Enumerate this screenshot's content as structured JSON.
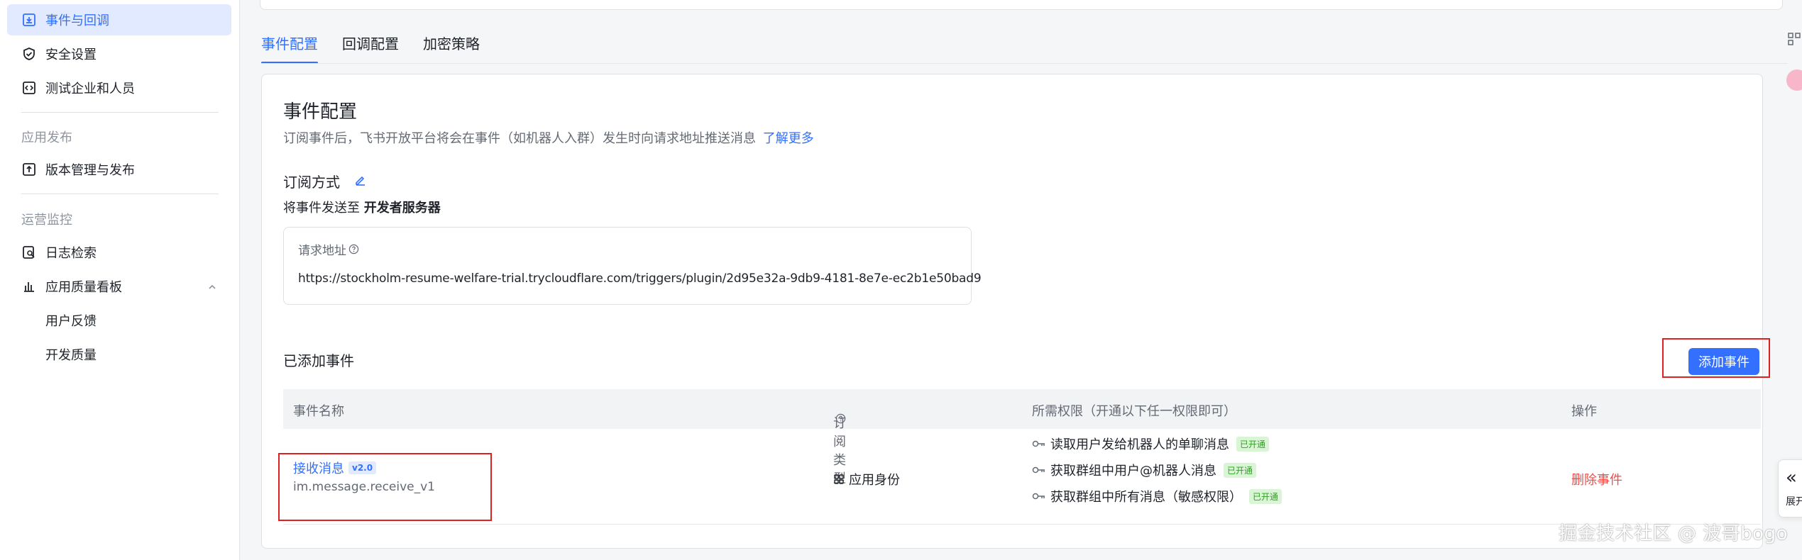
{
  "sidebar": {
    "items": [
      {
        "label": "事件与回调",
        "icon": "event-callback-icon",
        "active": true
      },
      {
        "label": "安全设置",
        "icon": "shield-icon"
      },
      {
        "label": "测试企业和人员",
        "icon": "code-box-icon"
      }
    ],
    "group_publish": "应用发布",
    "publish_items": [
      {
        "label": "版本管理与发布",
        "icon": "upload-box-icon"
      }
    ],
    "group_monitor": "运营监控",
    "monitor_items": [
      {
        "label": "日志检索",
        "icon": "log-search-icon"
      },
      {
        "label": "应用质量看板",
        "icon": "bar-chart-icon"
      }
    ],
    "sub_items": [
      {
        "label": "用户反馈"
      },
      {
        "label": "开发质量"
      }
    ]
  },
  "tabs": [
    {
      "label": "事件配置",
      "active": true
    },
    {
      "label": "回调配置"
    },
    {
      "label": "加密策略"
    }
  ],
  "section": {
    "title": "事件配置",
    "description": "订阅事件后，飞书开放平台将会在事件（如机器人入群）发生时向请求地址推送消息",
    "learn_more": "了解更多",
    "subscribe_mode_title": "订阅方式",
    "send_to_prefix": "将事件发送至",
    "send_to_target": "开发者服务器",
    "request_url_label": "请求地址",
    "request_url": "https://stockholm-resume-welfare-trial.trycloudflare.com/triggers/plugin/2d95e32a-9db9-4181-8e7e-ec2b1e50bad9"
  },
  "events": {
    "title": "已添加事件",
    "add_button": "添加事件",
    "columns": {
      "name": "事件名称",
      "sub_type": "订阅类型",
      "permissions": "所需权限（开通以下任一权限即可）",
      "actions": "操作"
    },
    "rows": [
      {
        "name": "接收消息",
        "version": "v2.0",
        "key": "im.message.receive_v1",
        "sub_type": "应用身份",
        "permissions": [
          {
            "label": "读取用户发给机器人的单聊消息",
            "status": "已开通"
          },
          {
            "label": "获取群组中用户@机器人消息",
            "status": "已开通"
          },
          {
            "label": "获取群组中所有消息（敏感权限）",
            "status": "已开通"
          }
        ],
        "action": "删除事件"
      }
    ]
  },
  "right_panel": {
    "expand_label": "展开"
  },
  "watermark": "掘金技术社区 @ 波哥bogo",
  "colors": {
    "accent": "#3370ff",
    "danger": "#f54a45",
    "highlight_frame": "#e02020",
    "success": "#2ea121"
  }
}
